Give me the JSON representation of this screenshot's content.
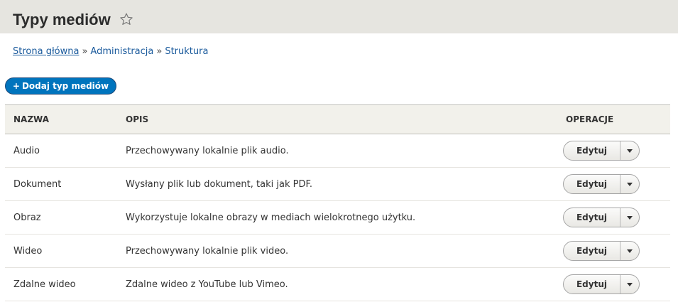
{
  "header": {
    "title": "Typy mediów"
  },
  "breadcrumb": [
    {
      "label": "Strona główna"
    },
    {
      "label": "Administracja"
    },
    {
      "label": "Struktura"
    }
  ],
  "breadcrumb_sep": "»",
  "actions": {
    "add_label": "Dodaj typ mediów",
    "add_icon": "+"
  },
  "table": {
    "columns": [
      "NAZWA",
      "OPIS",
      "OPERACJE"
    ],
    "rows": [
      {
        "name": "Audio",
        "description": "Przechowywany lokalnie plik audio.",
        "operation": "Edytuj"
      },
      {
        "name": "Dokument",
        "description": "Wysłany plik lub dokument, taki jak PDF.",
        "operation": "Edytuj"
      },
      {
        "name": "Obraz",
        "description": "Wykorzystuje lokalne obrazy w mediach wielokrotnego użytku.",
        "operation": "Edytuj"
      },
      {
        "name": "Wideo",
        "description": "Przechowywany lokalnie plik video.",
        "operation": "Edytuj"
      },
      {
        "name": "Zdalne wideo",
        "description": "Zdalne wideo z YouTube lub Vimeo.",
        "operation": "Edytuj"
      }
    ]
  },
  "colors": {
    "header_bg": "#e6e5e0",
    "primary_button": "#0074bd",
    "link": "#1a5a9c",
    "table_header_bg": "#f2f1eb"
  },
  "icons": {
    "favorite": "star-outline-icon",
    "dropdown": "caret-down-icon"
  }
}
